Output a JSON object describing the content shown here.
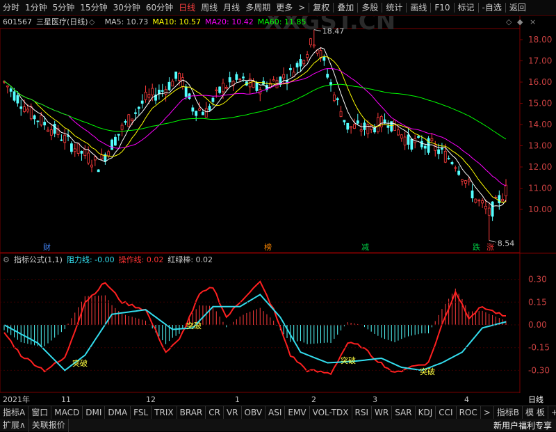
{
  "topbar": {
    "periods": [
      "分时",
      "1分钟",
      "5分钟",
      "15分钟",
      "30分钟",
      "60分钟",
      "日线",
      "周线",
      "月线",
      "多周期",
      "更多"
    ],
    "active": "日线",
    "more_arrow": ">",
    "actions": [
      "复权",
      "叠加",
      "多股",
      "统计",
      "画线",
      "F10",
      "标记",
      "-自选",
      "返回"
    ]
  },
  "stock": {
    "code": "601567",
    "name": "三星医疗(日线)"
  },
  "ma": [
    {
      "label": "MA5: 10.73",
      "color": "#ffffff"
    },
    {
      "label": "MA10: 10.57",
      "color": "#ffff00"
    },
    {
      "label": "MA20: 10.42",
      "color": "#ff00ff"
    },
    {
      "label": "MA60: 11.85",
      "color": "#00ff00"
    }
  ],
  "watermark": "XXGST.CN",
  "price_axis": [
    "18.00",
    "17.00",
    "16.00",
    "15.00",
    "14.00",
    "13.00",
    "12.00",
    "11.00",
    "10.00"
  ],
  "max_label": "18.47",
  "min_label": "8.54",
  "events": [
    {
      "text": "财",
      "color": "#4488ff"
    },
    {
      "text": "榜",
      "color": "#ff8800"
    },
    {
      "text": "减",
      "color": "#00cc44"
    },
    {
      "text": "跌",
      "color": "#00cc44"
    },
    {
      "text": "涨",
      "color": "#ff3333"
    }
  ],
  "indicator": {
    "name": "指标公式(1,1)",
    "items": [
      {
        "label": "阻力线: -0.00",
        "color": "#33ddee"
      },
      {
        "label": "操作线: 0.02",
        "color": "#ff3333"
      },
      {
        "label": "红绿棒: 0.02",
        "color": "#c8c8c8"
      }
    ],
    "axis": [
      "0.30",
      "0.15",
      "0.00",
      "-0.15",
      "-0.30"
    ],
    "signal": "突破"
  },
  "dates": [
    "2021年",
    "11",
    "12",
    "1",
    "2",
    "3",
    "4"
  ],
  "period_right": "日线",
  "tabs": [
    "指标A",
    "窗口",
    "MACD",
    "DMI",
    "DMA",
    "FSL",
    "TRIX",
    "BRAR",
    "CR",
    "VR",
    "OBV",
    "ASI",
    "EMV",
    "VOL-TDX",
    "RSI",
    "WR",
    "SAR",
    "KDJ",
    "CCI",
    "ROC",
    ">",
    "指标B",
    "模 板",
    "+",
    "-"
  ],
  "status": {
    "left1": "扩展∧",
    "left2": "关联报价",
    "right": "新用户福利专享"
  }
}
